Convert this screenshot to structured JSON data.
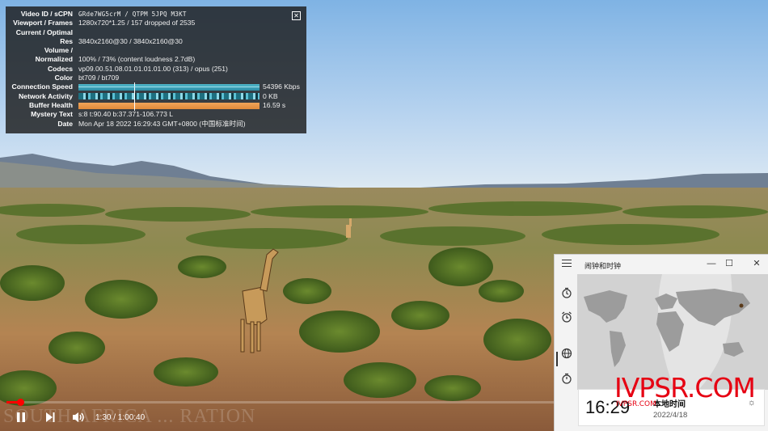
{
  "stats": {
    "rows": [
      {
        "k": "Video ID / sCPN",
        "v": "GRde7WG5crM / QTPM 5JPQ M3KT",
        "mono": true
      },
      {
        "k": "Viewport / Frames",
        "v": "1280x720*1.25 / 157 dropped of 2535",
        "mono": false
      },
      {
        "k": "Current / Optimal",
        "v": "",
        "mono": false
      },
      {
        "k": "Res",
        "v": "3840x2160@30 / 3840x2160@30",
        "mono": false
      },
      {
        "k": "Volume /",
        "v": "",
        "mono": false
      },
      {
        "k": "Normalized",
        "v": "100% / 73% (content loudness 2.7dB)",
        "mono": false
      },
      {
        "k": "Codecs",
        "v": "vp09.00.51.08.01.01.01.01.00 (313) / opus (251)",
        "mono": false
      },
      {
        "k": "Color",
        "v": "bt709 / bt709",
        "mono": false
      }
    ],
    "connection_speed": {
      "k": "Connection Speed",
      "v": "54396 Kbps"
    },
    "network_activity": {
      "k": "Network Activity",
      "v": "0 KB"
    },
    "buffer_health": {
      "k": "Buffer Health",
      "v": "16.59 s"
    },
    "mystery": {
      "k": "Mystery Text",
      "v": "s:8 t:90.40 b:37.371-106.773 L"
    },
    "date": {
      "k": "Date",
      "v": "Mon Apr 18 2022 16:29:43 GMT+0800 (中国标准时间)"
    },
    "close_label": "[X]"
  },
  "player": {
    "time": "1:30 / 1:00:40",
    "progress": 0.025,
    "watermark": "SOUTH AFRICA ... RATION"
  },
  "clock_app": {
    "title": "闹钟和时钟",
    "minimize": "—",
    "maximize": "☐",
    "close": "✕",
    "city": {
      "time": "16:29",
      "name": "本地时间",
      "date": "2022/4/18"
    }
  },
  "site_watermark": {
    "text": "IVPSR.COM",
    "sub": "IVPSR.COM"
  },
  "colors": {
    "accent_red": "#ff0000",
    "speed_graph": "#4fb7c9",
    "buffer_graph": "#f0a45a"
  }
}
